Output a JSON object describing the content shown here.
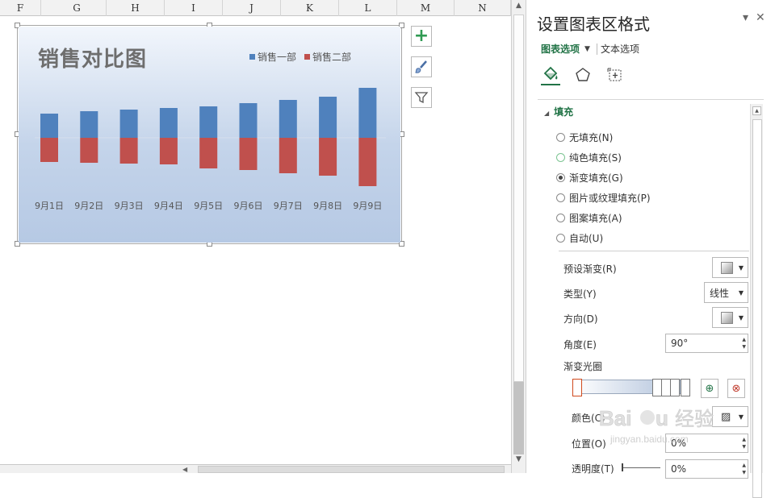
{
  "columns": [
    "F",
    "G",
    "H",
    "I",
    "J",
    "K",
    "L",
    "M",
    "N"
  ],
  "chart_tools": {
    "add_element": "+",
    "styles": "brush-icon",
    "filter": "filter-icon"
  },
  "chart_data": {
    "type": "bar",
    "title": "销售对比图",
    "categories": [
      "9月1日",
      "9月2日",
      "9月3日",
      "9月4日",
      "9月5日",
      "9月6日",
      "9月7日",
      "9月8日",
      "9月9日"
    ],
    "series": [
      {
        "name": "销售一部",
        "color": "#4f81bd",
        "values": [
          30,
          33,
          35,
          37,
          39,
          43,
          47,
          51,
          62
        ]
      },
      {
        "name": "销售二部",
        "color": "#c0504d",
        "values": [
          -30,
          -31,
          -32,
          -33,
          -38,
          -40,
          -44,
          -47,
          -60
        ]
      }
    ],
    "ylim": [
      -70,
      70
    ],
    "grid": false,
    "legend_position": "top-right"
  },
  "pane": {
    "title": "设置图表区格式",
    "tab_chart": "图表选项",
    "tab_text": "文本选项",
    "icons": [
      "fill-line-icon",
      "effects-icon",
      "size-properties-icon"
    ],
    "section": "填充",
    "fill_options": [
      {
        "label": "无填充(N)",
        "selected": false
      },
      {
        "label": "纯色填充(S)",
        "selected": false
      },
      {
        "label": "渐变填充(G)",
        "selected": true
      },
      {
        "label": "图片或纹理填充(P)",
        "selected": false
      },
      {
        "label": "图案填充(A)",
        "selected": false
      },
      {
        "label": "自动(U)",
        "selected": false
      }
    ],
    "preset_label": "预设渐变(R)",
    "type_label": "类型(Y)",
    "type_value": "线性",
    "direction_label": "方向(D)",
    "angle_label": "角度(E)",
    "angle_value": "90°",
    "stops_label": "渐变光圈",
    "color_label": "颜色(C)",
    "position_label": "位置(O)",
    "position_value": "0%",
    "transparency_label": "透明度(T)",
    "transparency_value": "0%"
  },
  "watermark": {
    "brand": "Baidu",
    "text": "经验",
    "url": "jingyan.baidu.com"
  }
}
